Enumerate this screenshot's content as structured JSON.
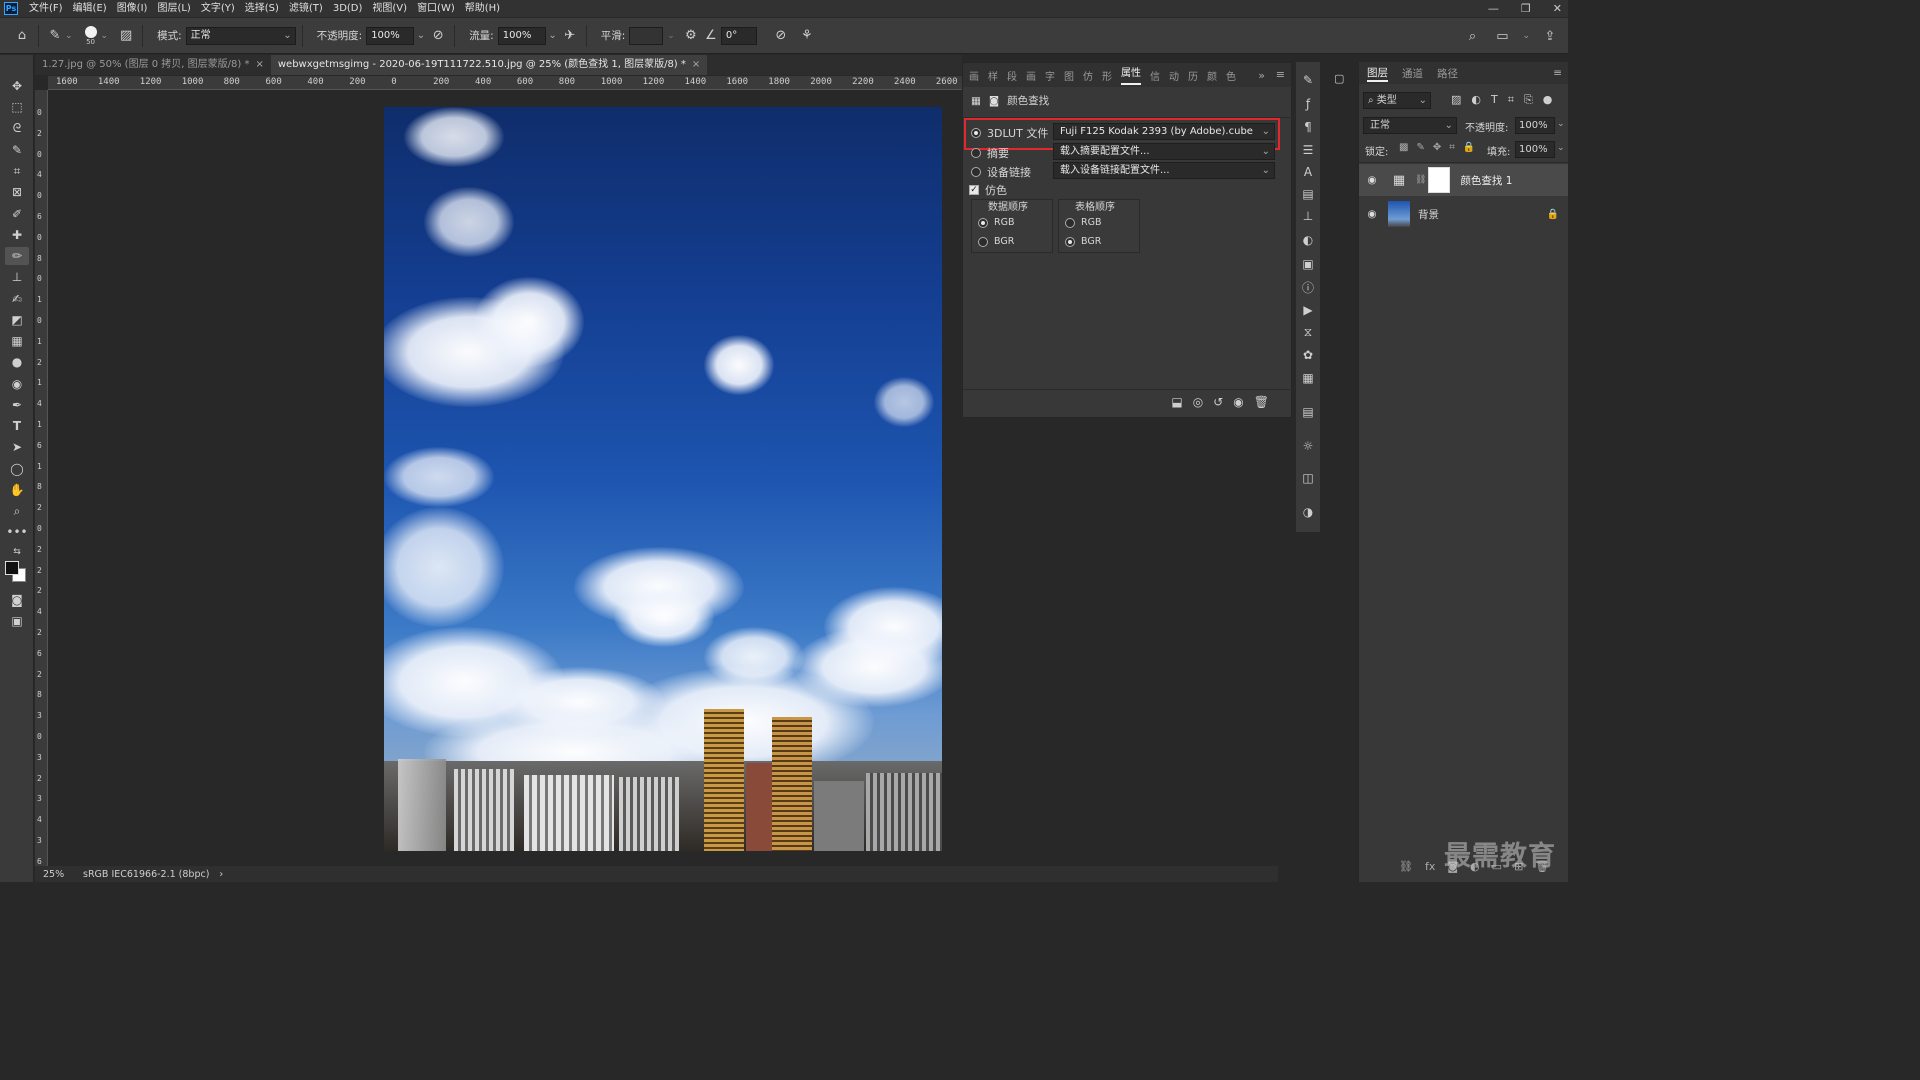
{
  "app": {
    "logo": "Ps"
  },
  "menu": [
    "文件(F)",
    "编辑(E)",
    "图像(I)",
    "图层(L)",
    "文字(Y)",
    "选择(S)",
    "滤镜(T)",
    "3D(D)",
    "视图(V)",
    "窗口(W)",
    "帮助(H)"
  ],
  "window_controls": [
    "—",
    "❐",
    "✕"
  ],
  "options": {
    "brush_size": "50",
    "mode_label": "模式:",
    "mode_value": "正常",
    "opacity_label": "不透明度:",
    "opacity_value": "100%",
    "flow_label": "流量:",
    "flow_value": "100%",
    "smooth_label": "平滑:",
    "smooth_value": "",
    "angle_value": "0°"
  },
  "tabs": [
    {
      "title": "1.27.jpg @ 50% (图层 0 拷贝, 图层蒙版/8) *",
      "active": false
    },
    {
      "title": "webwxgetmsgimg - 2020-06-19T111722.510.jpg @ 25% (颜色查找 1, 图层蒙版/8) *",
      "active": true
    }
  ],
  "ruler_h": [
    "1600",
    "1400",
    "1200",
    "1000",
    "800",
    "600",
    "400",
    "200",
    "0",
    "200",
    "400",
    "600",
    "800",
    "1000",
    "1200",
    "1400",
    "1600",
    "1800",
    "2000",
    "2200",
    "2400",
    "2600"
  ],
  "ruler_v": [
    "0",
    "2",
    "0",
    "4",
    "0",
    "6",
    "0",
    "8",
    "0",
    "1",
    "0",
    "1",
    "2",
    "1",
    "4",
    "1",
    "6",
    "1",
    "8",
    "2",
    "0",
    "2",
    "2",
    "2",
    "4",
    "2",
    "6",
    "2",
    "8",
    "3",
    "0",
    "3",
    "2",
    "3",
    "4",
    "3",
    "6"
  ],
  "status": {
    "zoom": "25%",
    "profile": "sRGB IEC61966-2.1 (8bpc)",
    "arrow": "›"
  },
  "properties": {
    "tabs": [
      "画",
      "样",
      "段",
      "画",
      "字",
      "图",
      "仿",
      "形",
      "属性",
      "信",
      "动",
      "历",
      "颜",
      "色"
    ],
    "active_tab": "属性",
    "panel_title": "颜色查找",
    "lut_label": "3DLUT 文件",
    "lut_value": "Fuji F125 Kodak 2393 (by Adobe).cube",
    "abstract_label": "摘要",
    "abstract_value": "载入摘要配置文件...",
    "device_label": "设备链接",
    "device_value": "载入设备链接配置文件...",
    "dither_label": "仿色",
    "data_order_label": "数据顺序",
    "table_order_label": "表格顺序",
    "rgb": "RGB",
    "bgr": "BGR"
  },
  "layers_panel": {
    "tabs": [
      "图层",
      "通道",
      "路径"
    ],
    "filter_label": "类型",
    "blend_mode": "正常",
    "opacity_label": "不透明度:",
    "opacity_value": "100%",
    "lock_label": "锁定:",
    "fill_label": "填充:",
    "fill_value": "100%",
    "layers": [
      {
        "name": "颜色查找 1",
        "selected": true
      },
      {
        "name": "背景",
        "selected": false
      }
    ]
  },
  "watermark": "最需教育",
  "colors": {
    "highlight_box": "#e0282e",
    "accent": "#31a8ff"
  }
}
